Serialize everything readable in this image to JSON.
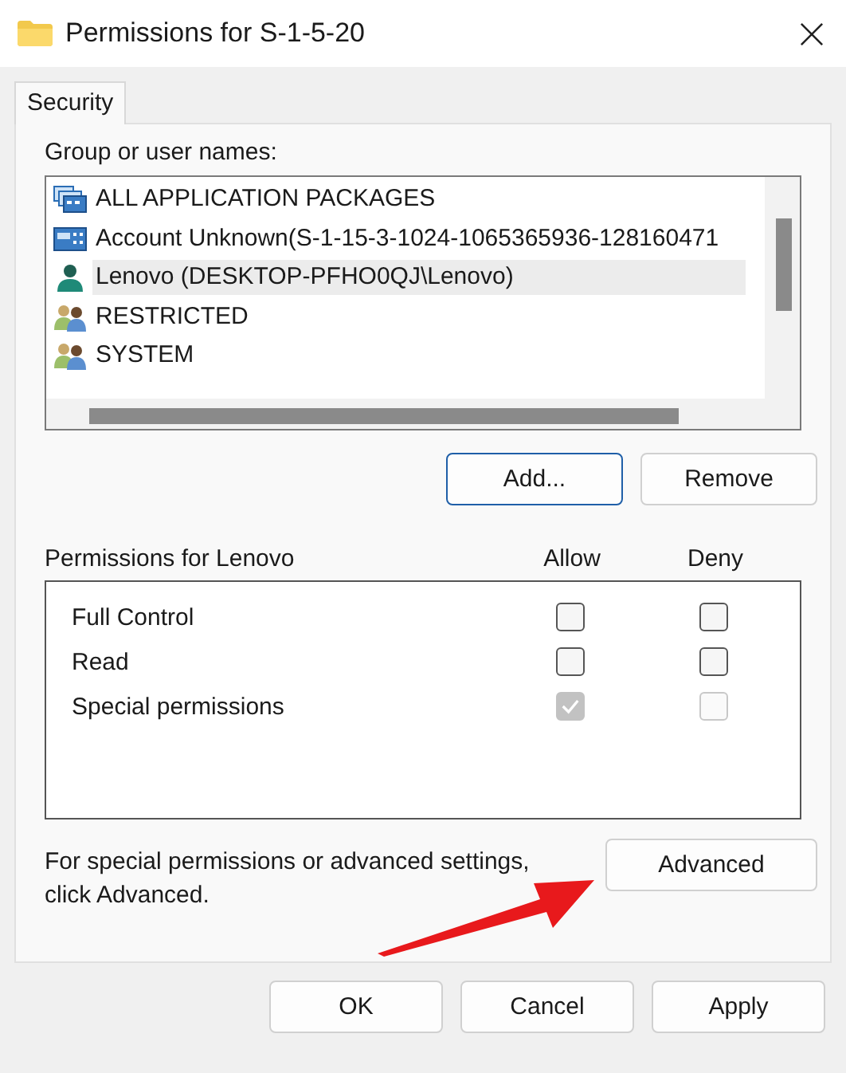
{
  "window": {
    "title": "Permissions for S-1-5-20"
  },
  "tabs": [
    {
      "label": "Security",
      "selected": true
    }
  ],
  "group_list": {
    "label": "Group or user names:",
    "items": [
      {
        "name": "ALL APPLICATION PACKAGES",
        "kind": "package",
        "selected": false
      },
      {
        "name": "Account Unknown(S-1-15-3-1024-1065365936-128160471",
        "kind": "account",
        "selected": false
      },
      {
        "name": "Lenovo (DESKTOP-PFHO0QJ\\Lenovo)",
        "kind": "user",
        "selected": true
      },
      {
        "name": "RESTRICTED",
        "kind": "group",
        "selected": false
      },
      {
        "name": "SYSTEM",
        "kind": "group",
        "selected": false
      }
    ]
  },
  "list_buttons": [
    "Add...",
    "Remove"
  ],
  "permissions": {
    "label": "Permissions for Lenovo",
    "allow_header": "Allow",
    "deny_header": "Deny",
    "rows": [
      {
        "name": "Full Control",
        "allow": {
          "checked": false,
          "disabled": false
        },
        "deny": {
          "checked": false,
          "disabled": false
        }
      },
      {
        "name": "Read",
        "allow": {
          "checked": false,
          "disabled": false
        },
        "deny": {
          "checked": false,
          "disabled": false
        }
      },
      {
        "name": "Special permissions",
        "allow": {
          "checked": true,
          "disabled": true
        },
        "deny": {
          "checked": false,
          "disabled": true
        }
      }
    ]
  },
  "advanced": {
    "text": "For special permissions or advanced settings, click Advanced.",
    "button": "Advanced"
  },
  "buttons": [
    "OK",
    "Cancel",
    "Apply"
  ]
}
